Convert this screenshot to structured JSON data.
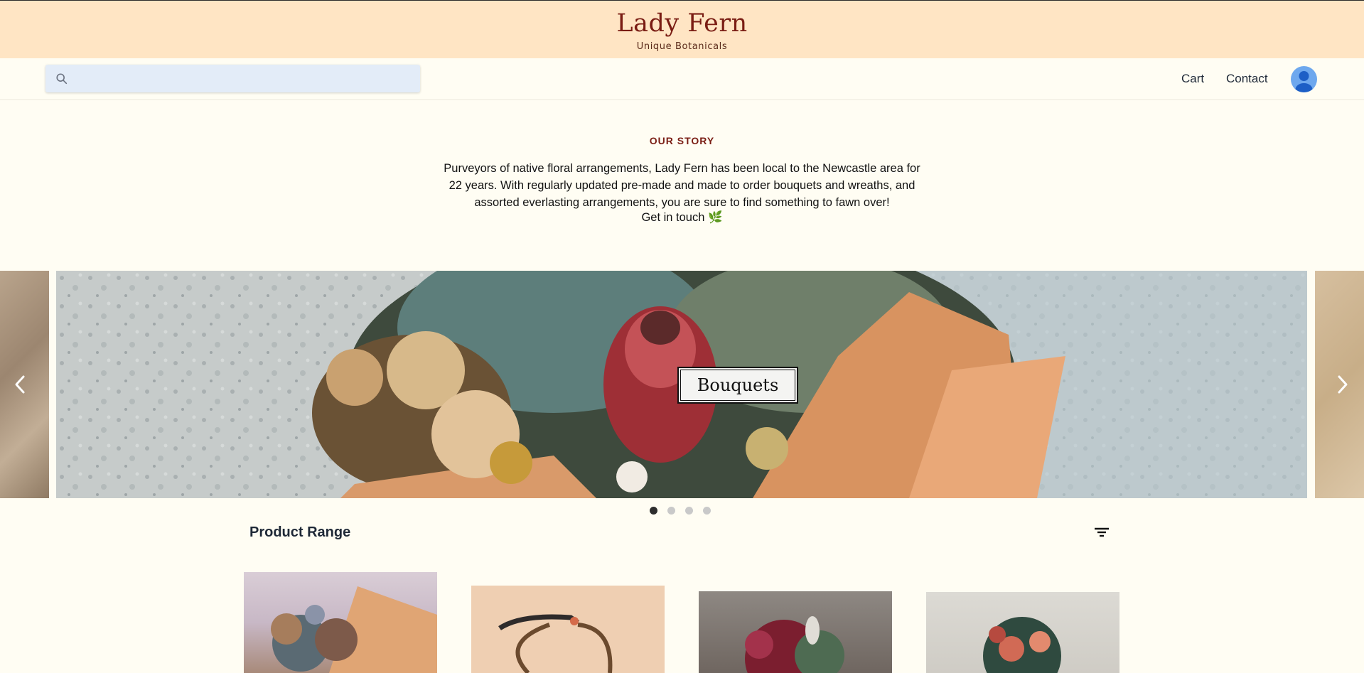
{
  "brand": {
    "title": "Lady Fern",
    "subtitle": "Unique Botanicals"
  },
  "nav": {
    "search": {
      "placeholder": "",
      "value": ""
    },
    "links": {
      "cart": "Cart",
      "contact": "Contact"
    },
    "icons": {
      "search": "search-icon",
      "avatar": "user-avatar-icon"
    }
  },
  "story": {
    "heading": "OUR STORY",
    "body": "Purveyors of native floral arrangements, Lady Fern has been local to the Newcastle area for 22 years. With regularly updated pre-made and made to order bouquets and wreaths, and assorted everlasting arrangements, you are sure to find something to fawn over!",
    "cta": "Get in touch 🌿"
  },
  "carousel": {
    "current_caption": "Bouquets",
    "slide_count": 4,
    "active_index": 0,
    "icons": {
      "prev": "chevron-left-icon",
      "next": "chevron-right-icon"
    }
  },
  "products": {
    "section_title": "Product Range",
    "filter_icon": "filter-icon",
    "items": [
      {
        "kind": "bouquet"
      },
      {
        "kind": "wreath"
      },
      {
        "kind": "bouquet"
      },
      {
        "kind": "bouquet"
      }
    ]
  },
  "colors": {
    "brand_bar": "#ffe5c4",
    "brand_text": "#7a1d14",
    "page_bg": "#fffdf3",
    "search_bg": "#e3ecf8",
    "avatar": "#6ea8ee",
    "dot_active": "#2d2d2d",
    "dot_inactive": "#c9c9c9"
  }
}
